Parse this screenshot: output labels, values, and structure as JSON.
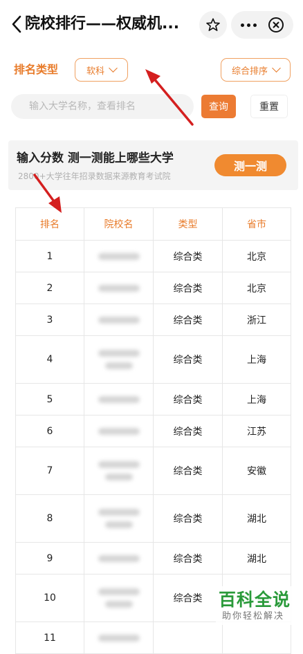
{
  "nav": {
    "title": "院校排行——权威机..."
  },
  "filters": {
    "type_label": "排名类型",
    "type_value": "软科",
    "sort_value": "综合排序"
  },
  "search": {
    "placeholder": "输入大学名称，查看排名",
    "value": "",
    "query_label": "查询",
    "reset_label": "重置"
  },
  "promo": {
    "title": "输入分数 测一测能上哪些大学",
    "subtitle": "2800+大学往年招录数据来源教育考试院",
    "button_label": "测一测"
  },
  "table": {
    "headers": [
      "排名",
      "院校名",
      "类型",
      "省市"
    ],
    "rows": [
      {
        "rank": "1",
        "type": "综合类",
        "city": "北京"
      },
      {
        "rank": "2",
        "type": "综合类",
        "city": "北京"
      },
      {
        "rank": "3",
        "type": "综合类",
        "city": "浙江"
      },
      {
        "rank": "4",
        "type": "综合类",
        "city": "上海"
      },
      {
        "rank": "5",
        "type": "综合类",
        "city": "上海"
      },
      {
        "rank": "6",
        "type": "综合类",
        "city": "江苏"
      },
      {
        "rank": "7",
        "type": "综合类",
        "city": "安徽"
      },
      {
        "rank": "8",
        "type": "综合类",
        "city": "湖北"
      },
      {
        "rank": "9",
        "type": "综合类",
        "city": "湖北"
      },
      {
        "rank": "10",
        "type": "综合类",
        "city": ""
      },
      {
        "rank": "11",
        "type": "",
        "city": ""
      }
    ]
  },
  "watermark": {
    "main": "百科全说",
    "sub": "助你轻松解决"
  },
  "colors": {
    "accent": "#e87b2a",
    "button": "#ec7b33",
    "promo_button": "#f08a30",
    "arrow": "#d41f1f",
    "watermark": "#2a9a3a"
  },
  "icons": [
    "back-arrow-icon",
    "star-icon",
    "more-dots-icon",
    "close-circle-icon",
    "chevron-down-icon"
  ]
}
